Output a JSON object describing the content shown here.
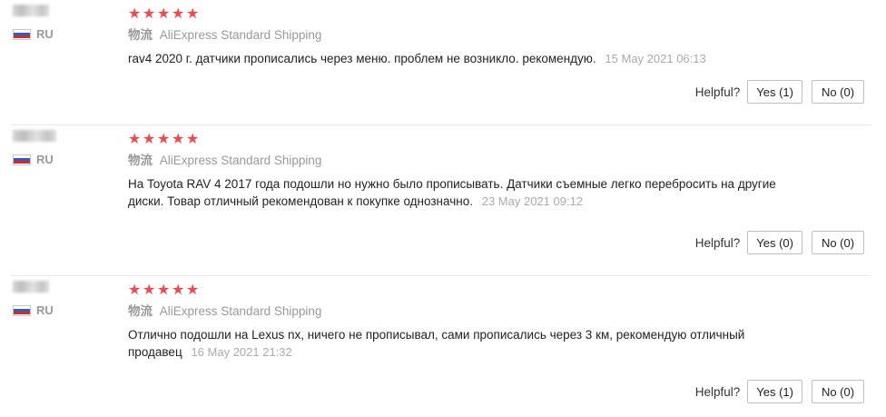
{
  "reviews": [
    {
      "country": "RU",
      "rating": 5,
      "shipping_prefix": "物流",
      "shipping": "AliExpress Standard Shipping",
      "text": "rav4 2020 г. датчики прописались через меню. проблем не возникло. рекомендую.",
      "date": "15 May 2021 06:13",
      "helpful_label": "Helpful?",
      "yes_label": "Yes (1)",
      "no_label": "No (0)"
    },
    {
      "country": "RU",
      "rating": 5,
      "shipping_prefix": "物流",
      "shipping": "AliExpress Standard Shipping",
      "text": "На Toyota RAV 4 2017 года подошли но нужно было прописывать. Датчики съемные легко перебросить на другие диски. Товар отличный рекомендован к покупке однозначно.",
      "date": "23 May 2021 09:12",
      "helpful_label": "Helpful?",
      "yes_label": "Yes (0)",
      "no_label": "No (0)"
    },
    {
      "country": "RU",
      "rating": 5,
      "shipping_prefix": "物流",
      "shipping": "AliExpress Standard Shipping",
      "text": "Отлично подошли на Lexus nx, ничего не прописывал, сами прописались через 3 км, рекомендую отличный продавец",
      "date": "16 May 2021 21:32",
      "helpful_label": "Helpful?",
      "yes_label": "Yes (1)",
      "no_label": "No (0)"
    }
  ],
  "colors": {
    "star": "#f0494c",
    "muted": "#999999",
    "divider": "#e6e6e6"
  },
  "icons": {
    "star": "star-icon",
    "flag": "russia-flag-icon"
  }
}
